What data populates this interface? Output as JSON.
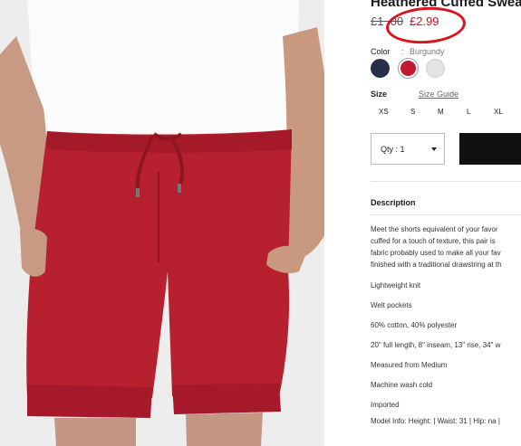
{
  "product": {
    "title": "Heathered Cuffed Sweat",
    "old_price": "£1 .00",
    "new_price": "£2.99"
  },
  "color": {
    "label": "Color",
    "separator": ":",
    "selected": "Burgundy",
    "swatches": [
      {
        "name": "navy",
        "hex": "#27304a"
      },
      {
        "name": "burgundy",
        "hex": "#c11a30"
      },
      {
        "name": "grey",
        "hex": "#e4e4e4"
      }
    ]
  },
  "size": {
    "label": "Size",
    "guide_link": "Size Guide",
    "options": [
      "XS",
      "S",
      "M",
      "L",
      "XL"
    ]
  },
  "quantity": {
    "label": "Qty : 1"
  },
  "description": {
    "heading": "Description",
    "paragraph_lines": [
      "Meet the shorts equivalent of your favor",
      "cuffed for a touch of texture, this pair is",
      "fabric probably used to make all your fav",
      "finished with a traditional drawstring at th"
    ],
    "details": [
      "Lightweight knit",
      "Welt pockets",
      "60% cotton, 40% polyester",
      "20\" full length, 8\" inseam, 13\" rise, 34\" w",
      "Measured from Medium",
      "Machine wash cold",
      "Imported",
      "Model Info: Height: | Waist: 31 | Hip: na |"
    ]
  },
  "colors": {
    "accent_red": "#d8141e",
    "sale_price": "#c8141e",
    "button": "#111111"
  }
}
